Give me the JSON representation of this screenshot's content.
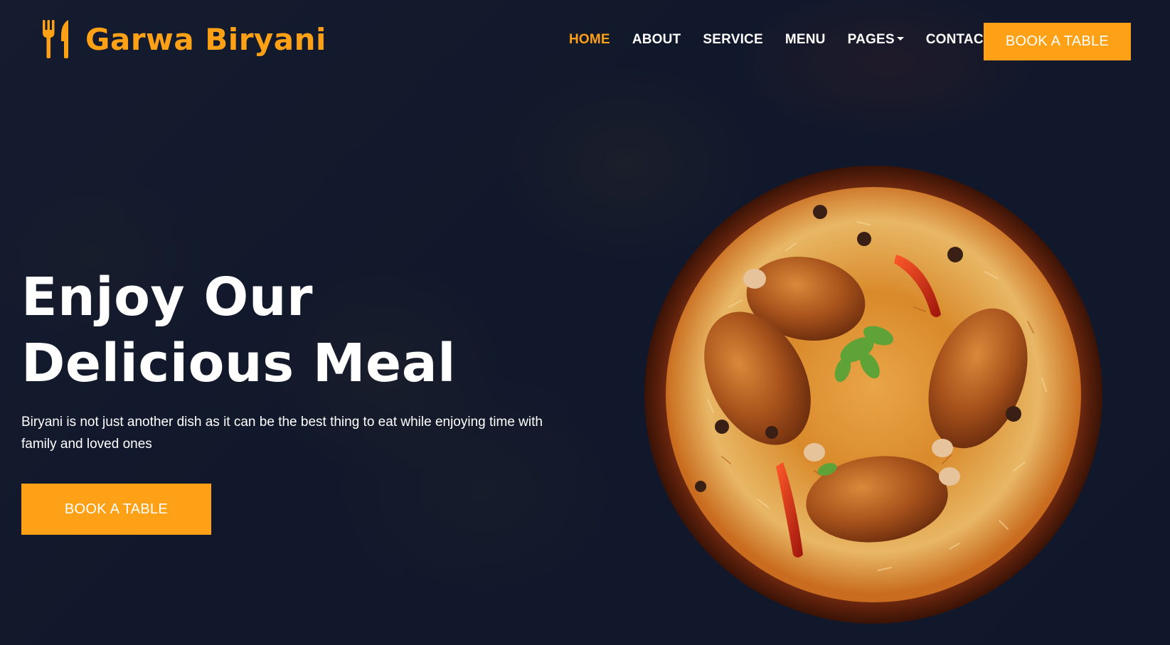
{
  "brand": {
    "name": "Garwa Biryani",
    "icon": "utensils-icon",
    "color": "#FEA116"
  },
  "nav": {
    "items": [
      {
        "label": "HOME",
        "active": true
      },
      {
        "label": "ABOUT",
        "active": false
      },
      {
        "label": "SERVICE",
        "active": false
      },
      {
        "label": "MENU",
        "active": false
      },
      {
        "label": "PAGES",
        "active": false,
        "dropdown": true
      },
      {
        "label": "CONTACT",
        "active": false
      }
    ],
    "cta_label": "BOOK A TABLE"
  },
  "hero": {
    "title": "Enjoy Our\nDelicious Meal",
    "description": "Biryani is not just another dish as it can be the best thing to eat while enjoying time with family and loved ones",
    "cta_label": "BOOK A TABLE",
    "image": "biryani-plate-image"
  },
  "colors": {
    "accent": "#FEA116",
    "overlay": "#0F172B",
    "text": "#FFFFFF"
  }
}
